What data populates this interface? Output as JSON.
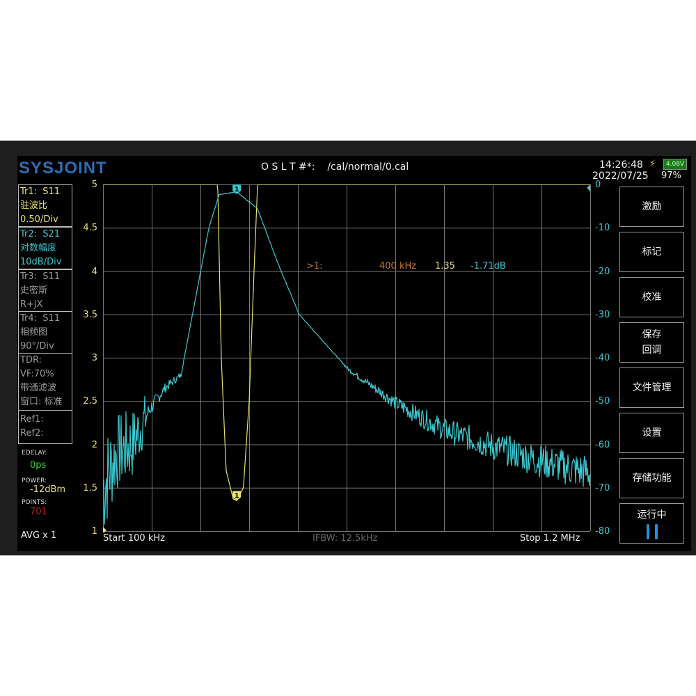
{
  "header": {
    "logo": "SYSJOINT",
    "cal_label": "O S L T #*:",
    "cal_path": "/cal/normal/0.cal",
    "time": "14:26:48",
    "date": "2022/07/25",
    "battery_voltage": "4.08V",
    "battery_percent": "97%"
  },
  "traces": [
    {
      "id": "Tr1:",
      "param": "S11",
      "format": "驻波比",
      "scale": "0.50/Div"
    },
    {
      "id": "Tr2:",
      "param": "S21",
      "format": "对数幅度",
      "scale": "10dB/Div"
    },
    {
      "id": "Tr3:",
      "param": "S11",
      "format": "史密斯",
      "scale": "R+jX"
    },
    {
      "id": "Tr4:",
      "param": "S11",
      "format": "相频图",
      "scale": "90°/Div"
    }
  ],
  "tdr": {
    "title": "TDR:",
    "vf": "VF:70%",
    "mode": "带通滤波",
    "window": "窗口: 标准"
  },
  "refs": [
    "Ref1:",
    "Ref2:"
  ],
  "status": {
    "edelay_label": "EDELAY:",
    "edelay": "0ps",
    "power_label": "POWER:",
    "power": "-12dBm",
    "points_label": "POINTS:",
    "points": "701",
    "avg": "AVG x 1"
  },
  "marker": {
    "label": ">1:",
    "freq": "400 kHz",
    "vswr": "1.35",
    "s21": "-1.71dB",
    "number": "1"
  },
  "axes": {
    "left_ticks": [
      "5",
      "4.5",
      "4",
      "3.5",
      "3",
      "2.5",
      "2",
      "1.5",
      "1"
    ],
    "right_ticks": [
      "0",
      "-10",
      "-20",
      "-30",
      "-40",
      "-50",
      "-60",
      "-70",
      "-80"
    ]
  },
  "footer": {
    "start": "Start   100 kHz",
    "ifbw": "IFBW: 12.5kHz",
    "stop": "Stop   1.2 MHz"
  },
  "buttons": [
    [
      "激励"
    ],
    [
      "标记"
    ],
    [
      "校准"
    ],
    [
      "保存",
      "回调"
    ],
    [
      "文件管理"
    ],
    [
      "设置"
    ],
    [
      "存储功能"
    ],
    [
      "运行中"
    ]
  ],
  "colors": {
    "s11": "#e8e070",
    "s21": "#3cc8d0",
    "grid": "#777777"
  },
  "chart_data": {
    "type": "line",
    "x_range_khz": [
      100,
      1200
    ],
    "series": [
      {
        "name": "S11 VSWR",
        "ylim": [
          1,
          5
        ],
        "x": [
          100,
          359,
          367,
          378,
          394,
          402,
          417,
          430,
          441,
          449,
          1200
        ],
        "y": [
          5,
          5,
          3,
          1.7,
          1.37,
          1.35,
          1.5,
          2.5,
          4,
          5,
          5
        ]
      },
      {
        "name": "S21 LogMag",
        "ylim": [
          -80,
          0
        ],
        "x": [
          100,
          130,
          166,
          205,
          240,
          276,
          339,
          362,
          402,
          449,
          496,
          543,
          653,
          763,
          873,
          967,
          1077,
          1200
        ],
        "y": [
          -70,
          -62,
          -60,
          -52,
          -47,
          -44,
          -10,
          -2.4,
          -1.71,
          -5.6,
          -18.5,
          -30,
          -42.6,
          -50.6,
          -56.7,
          -60,
          -63.5,
          -66.7
        ]
      }
    ]
  }
}
